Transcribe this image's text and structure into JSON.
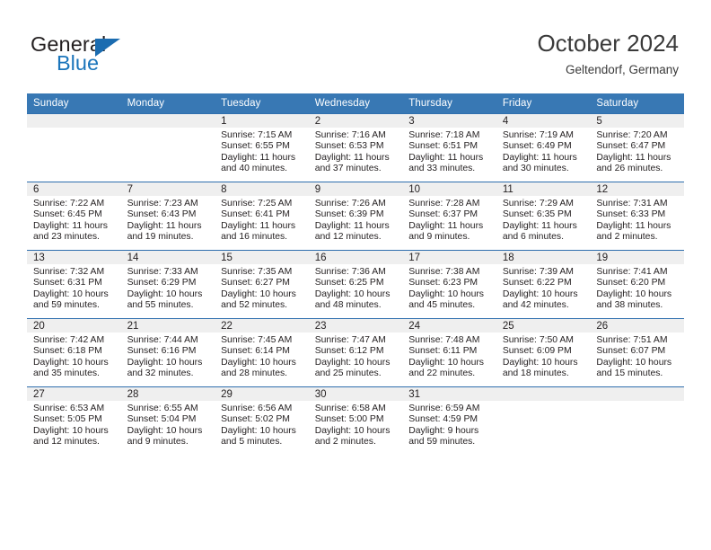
{
  "brand": {
    "word_top": "General",
    "word_bottom": "Blue",
    "accent_color": "#1b75bb",
    "triangle_icon": "triangle-logo-icon"
  },
  "header": {
    "title": "October 2024",
    "subtitle": "Geltendorf, Germany",
    "header_bg_color": "#3878b4",
    "row_divider_color": "#2f6fae",
    "daynum_band_color": "#efefef"
  },
  "weekday_headers": [
    "Sunday",
    "Monday",
    "Tuesday",
    "Wednesday",
    "Thursday",
    "Friday",
    "Saturday"
  ],
  "labels": {
    "sunrise": "Sunrise:",
    "sunset": "Sunset:",
    "daylight": "Daylight:"
  },
  "weeks": [
    [
      {
        "day": ""
      },
      {
        "day": ""
      },
      {
        "day": "1",
        "sunrise": "Sunrise: 7:15 AM",
        "sunset": "Sunset: 6:55 PM",
        "daylight_1": "Daylight: 11 hours",
        "daylight_2": "and 40 minutes."
      },
      {
        "day": "2",
        "sunrise": "Sunrise: 7:16 AM",
        "sunset": "Sunset: 6:53 PM",
        "daylight_1": "Daylight: 11 hours",
        "daylight_2": "and 37 minutes."
      },
      {
        "day": "3",
        "sunrise": "Sunrise: 7:18 AM",
        "sunset": "Sunset: 6:51 PM",
        "daylight_1": "Daylight: 11 hours",
        "daylight_2": "and 33 minutes."
      },
      {
        "day": "4",
        "sunrise": "Sunrise: 7:19 AM",
        "sunset": "Sunset: 6:49 PM",
        "daylight_1": "Daylight: 11 hours",
        "daylight_2": "and 30 minutes."
      },
      {
        "day": "5",
        "sunrise": "Sunrise: 7:20 AM",
        "sunset": "Sunset: 6:47 PM",
        "daylight_1": "Daylight: 11 hours",
        "daylight_2": "and 26 minutes."
      }
    ],
    [
      {
        "day": "6",
        "sunrise": "Sunrise: 7:22 AM",
        "sunset": "Sunset: 6:45 PM",
        "daylight_1": "Daylight: 11 hours",
        "daylight_2": "and 23 minutes."
      },
      {
        "day": "7",
        "sunrise": "Sunrise: 7:23 AM",
        "sunset": "Sunset: 6:43 PM",
        "daylight_1": "Daylight: 11 hours",
        "daylight_2": "and 19 minutes."
      },
      {
        "day": "8",
        "sunrise": "Sunrise: 7:25 AM",
        "sunset": "Sunset: 6:41 PM",
        "daylight_1": "Daylight: 11 hours",
        "daylight_2": "and 16 minutes."
      },
      {
        "day": "9",
        "sunrise": "Sunrise: 7:26 AM",
        "sunset": "Sunset: 6:39 PM",
        "daylight_1": "Daylight: 11 hours",
        "daylight_2": "and 12 minutes."
      },
      {
        "day": "10",
        "sunrise": "Sunrise: 7:28 AM",
        "sunset": "Sunset: 6:37 PM",
        "daylight_1": "Daylight: 11 hours",
        "daylight_2": "and 9 minutes."
      },
      {
        "day": "11",
        "sunrise": "Sunrise: 7:29 AM",
        "sunset": "Sunset: 6:35 PM",
        "daylight_1": "Daylight: 11 hours",
        "daylight_2": "and 6 minutes."
      },
      {
        "day": "12",
        "sunrise": "Sunrise: 7:31 AM",
        "sunset": "Sunset: 6:33 PM",
        "daylight_1": "Daylight: 11 hours",
        "daylight_2": "and 2 minutes."
      }
    ],
    [
      {
        "day": "13",
        "sunrise": "Sunrise: 7:32 AM",
        "sunset": "Sunset: 6:31 PM",
        "daylight_1": "Daylight: 10 hours",
        "daylight_2": "and 59 minutes."
      },
      {
        "day": "14",
        "sunrise": "Sunrise: 7:33 AM",
        "sunset": "Sunset: 6:29 PM",
        "daylight_1": "Daylight: 10 hours",
        "daylight_2": "and 55 minutes."
      },
      {
        "day": "15",
        "sunrise": "Sunrise: 7:35 AM",
        "sunset": "Sunset: 6:27 PM",
        "daylight_1": "Daylight: 10 hours",
        "daylight_2": "and 52 minutes."
      },
      {
        "day": "16",
        "sunrise": "Sunrise: 7:36 AM",
        "sunset": "Sunset: 6:25 PM",
        "daylight_1": "Daylight: 10 hours",
        "daylight_2": "and 48 minutes."
      },
      {
        "day": "17",
        "sunrise": "Sunrise: 7:38 AM",
        "sunset": "Sunset: 6:23 PM",
        "daylight_1": "Daylight: 10 hours",
        "daylight_2": "and 45 minutes."
      },
      {
        "day": "18",
        "sunrise": "Sunrise: 7:39 AM",
        "sunset": "Sunset: 6:22 PM",
        "daylight_1": "Daylight: 10 hours",
        "daylight_2": "and 42 minutes."
      },
      {
        "day": "19",
        "sunrise": "Sunrise: 7:41 AM",
        "sunset": "Sunset: 6:20 PM",
        "daylight_1": "Daylight: 10 hours",
        "daylight_2": "and 38 minutes."
      }
    ],
    [
      {
        "day": "20",
        "sunrise": "Sunrise: 7:42 AM",
        "sunset": "Sunset: 6:18 PM",
        "daylight_1": "Daylight: 10 hours",
        "daylight_2": "and 35 minutes."
      },
      {
        "day": "21",
        "sunrise": "Sunrise: 7:44 AM",
        "sunset": "Sunset: 6:16 PM",
        "daylight_1": "Daylight: 10 hours",
        "daylight_2": "and 32 minutes."
      },
      {
        "day": "22",
        "sunrise": "Sunrise: 7:45 AM",
        "sunset": "Sunset: 6:14 PM",
        "daylight_1": "Daylight: 10 hours",
        "daylight_2": "and 28 minutes."
      },
      {
        "day": "23",
        "sunrise": "Sunrise: 7:47 AM",
        "sunset": "Sunset: 6:12 PM",
        "daylight_1": "Daylight: 10 hours",
        "daylight_2": "and 25 minutes."
      },
      {
        "day": "24",
        "sunrise": "Sunrise: 7:48 AM",
        "sunset": "Sunset: 6:11 PM",
        "daylight_1": "Daylight: 10 hours",
        "daylight_2": "and 22 minutes."
      },
      {
        "day": "25",
        "sunrise": "Sunrise: 7:50 AM",
        "sunset": "Sunset: 6:09 PM",
        "daylight_1": "Daylight: 10 hours",
        "daylight_2": "and 18 minutes."
      },
      {
        "day": "26",
        "sunrise": "Sunrise: 7:51 AM",
        "sunset": "Sunset: 6:07 PM",
        "daylight_1": "Daylight: 10 hours",
        "daylight_2": "and 15 minutes."
      }
    ],
    [
      {
        "day": "27",
        "sunrise": "Sunrise: 6:53 AM",
        "sunset": "Sunset: 5:05 PM",
        "daylight_1": "Daylight: 10 hours",
        "daylight_2": "and 12 minutes."
      },
      {
        "day": "28",
        "sunrise": "Sunrise: 6:55 AM",
        "sunset": "Sunset: 5:04 PM",
        "daylight_1": "Daylight: 10 hours",
        "daylight_2": "and 9 minutes."
      },
      {
        "day": "29",
        "sunrise": "Sunrise: 6:56 AM",
        "sunset": "Sunset: 5:02 PM",
        "daylight_1": "Daylight: 10 hours",
        "daylight_2": "and 5 minutes."
      },
      {
        "day": "30",
        "sunrise": "Sunrise: 6:58 AM",
        "sunset": "Sunset: 5:00 PM",
        "daylight_1": "Daylight: 10 hours",
        "daylight_2": "and 2 minutes."
      },
      {
        "day": "31",
        "sunrise": "Sunrise: 6:59 AM",
        "sunset": "Sunset: 4:59 PM",
        "daylight_1": "Daylight: 9 hours",
        "daylight_2": "and 59 minutes."
      },
      {
        "day": ""
      },
      {
        "day": ""
      }
    ]
  ]
}
